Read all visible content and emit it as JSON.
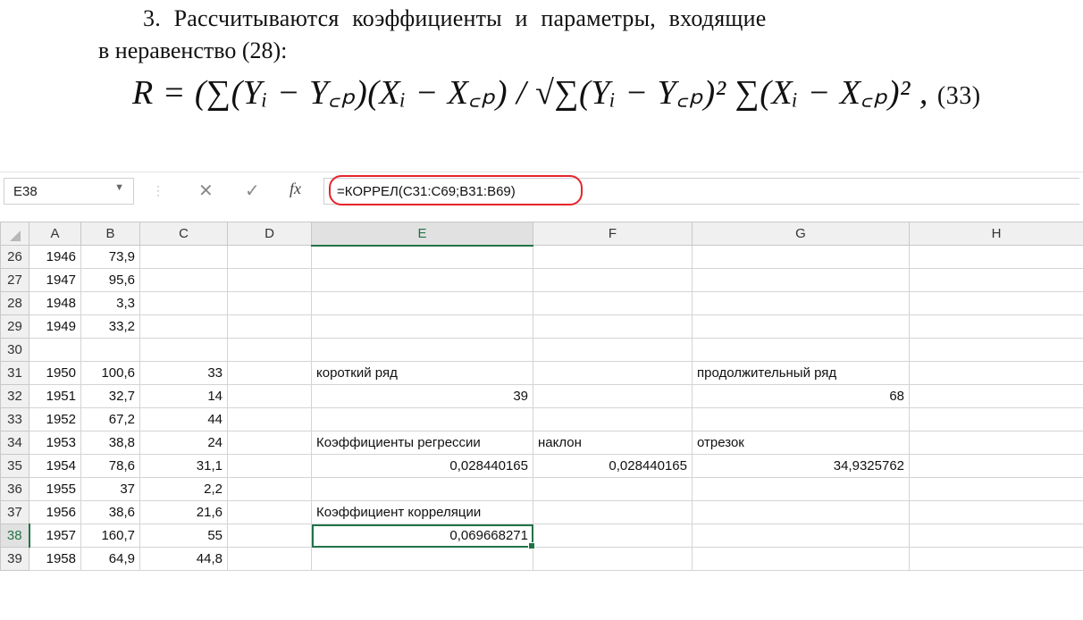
{
  "document": {
    "line1": "3. Рассчитываются коэффициенты и параметры, входящие",
    "line2": "в неравенство (28):",
    "formula": "R = (∑(Yᵢ − Y꜀ₚ)(Xᵢ − X꜀ₚ) / √∑(Yᵢ − Y꜀ₚ)² ∑(Xᵢ − X꜀ₚ)² ,",
    "formula_number": "(33)"
  },
  "formula_bar": {
    "name_box": "E38",
    "formula": "=КОРРЕЛ(C31:C69;B31:B69)"
  },
  "icons": {
    "dropdown": "chevron-down-icon",
    "cancel": "close-icon",
    "enter": "check-icon",
    "function": "fx-icon"
  },
  "colors": {
    "accent": "#217346",
    "highlight_ring": "#e5242a"
  },
  "columns": [
    "A",
    "B",
    "C",
    "D",
    "E",
    "F",
    "G",
    "H"
  ],
  "rows": [
    {
      "n": "26",
      "A": "1946",
      "B": "73,9",
      "C": "",
      "D": "",
      "E": "",
      "F": "",
      "G": "",
      "H": ""
    },
    {
      "n": "27",
      "A": "1947",
      "B": "95,6",
      "C": "",
      "D": "",
      "E": "",
      "F": "",
      "G": "",
      "H": ""
    },
    {
      "n": "28",
      "A": "1948",
      "B": "3,3",
      "C": "",
      "D": "",
      "E": "",
      "F": "",
      "G": "",
      "H": ""
    },
    {
      "n": "29",
      "A": "1949",
      "B": "33,2",
      "C": "",
      "D": "",
      "E": "",
      "F": "",
      "G": "",
      "H": ""
    },
    {
      "n": "30",
      "A": "",
      "B": "",
      "C": "",
      "D": "",
      "E": "",
      "F": "",
      "G": "",
      "H": ""
    },
    {
      "n": "31",
      "A": "1950",
      "B": "100,6",
      "C": "33",
      "D": "",
      "E": "короткий ряд",
      "F": "",
      "G": "продолжительный ряд",
      "H": ""
    },
    {
      "n": "32",
      "A": "1951",
      "B": "32,7",
      "C": "14",
      "D": "",
      "E": "39",
      "F": "",
      "G": "68",
      "H": ""
    },
    {
      "n": "33",
      "A": "1952",
      "B": "67,2",
      "C": "44",
      "D": "",
      "E": "",
      "F": "",
      "G": "",
      "H": ""
    },
    {
      "n": "34",
      "A": "1953",
      "B": "38,8",
      "C": "24",
      "D": "",
      "E": "Коэффициенты регрессии",
      "F": "наклон",
      "G": "отрезок",
      "H": ""
    },
    {
      "n": "35",
      "A": "1954",
      "B": "78,6",
      "C": "31,1",
      "D": "",
      "E": "0,028440165",
      "F": "0,028440165",
      "G": "34,9325762",
      "H": ""
    },
    {
      "n": "36",
      "A": "1955",
      "B": "37",
      "C": "2,2",
      "D": "",
      "E": "",
      "F": "",
      "G": "",
      "H": ""
    },
    {
      "n": "37",
      "A": "1956",
      "B": "38,6",
      "C": "21,6",
      "D": "",
      "E": "Коэффициент корреляции",
      "F": "",
      "G": "",
      "H": ""
    },
    {
      "n": "38",
      "A": "1957",
      "B": "160,7",
      "C": "55",
      "D": "",
      "E": "0,069668271",
      "F": "",
      "G": "",
      "H": ""
    },
    {
      "n": "39",
      "A": "1958",
      "B": "64,9",
      "C": "44,8",
      "D": "",
      "E": "",
      "F": "",
      "G": "",
      "H": ""
    }
  ]
}
